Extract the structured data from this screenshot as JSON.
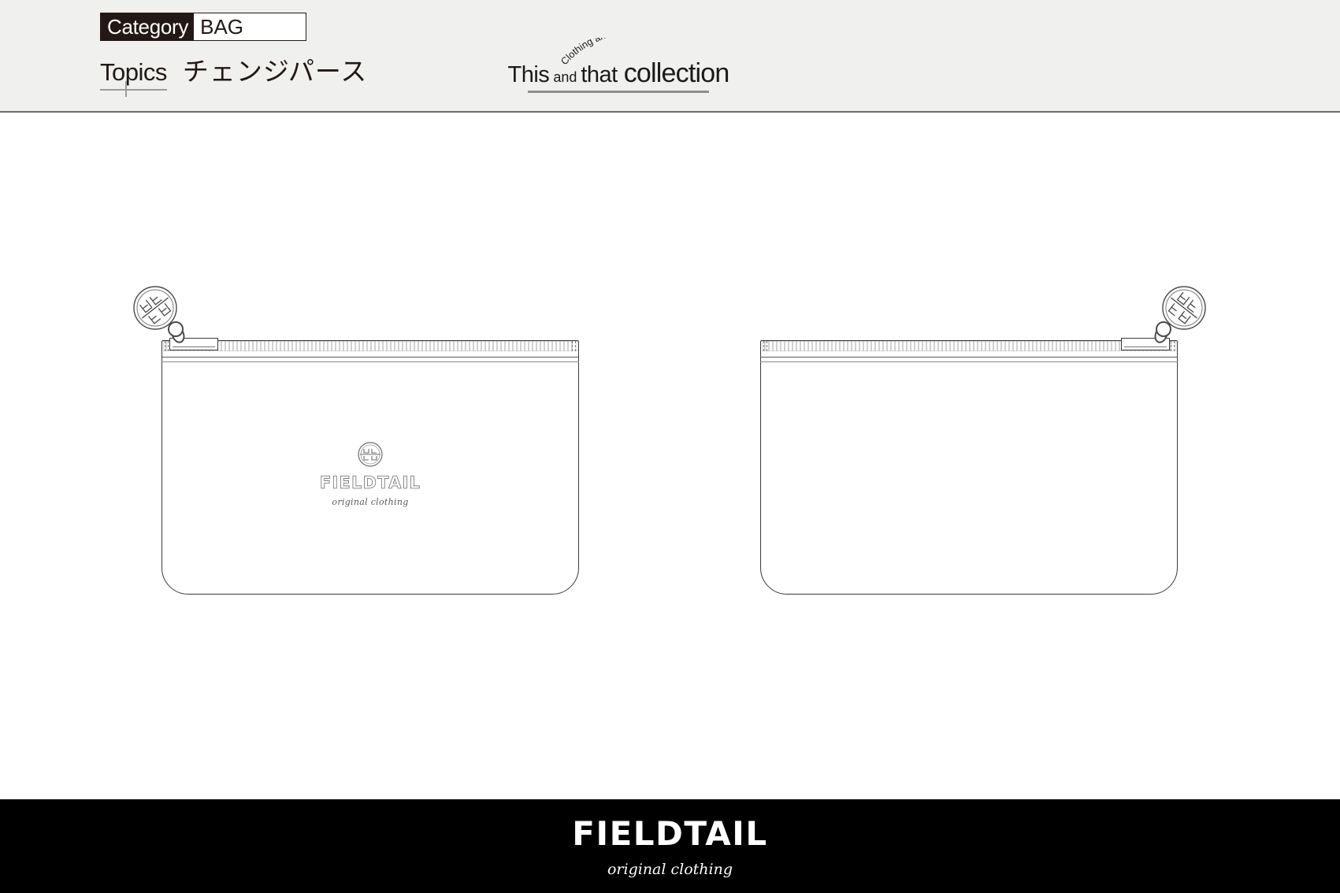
{
  "header": {
    "category_label": "Category",
    "category_value": "BAG",
    "topics_label": "Topics",
    "topics_value": "チェンジパース",
    "brand": {
      "arc_text": "Clothing and accessories",
      "word_this": "This",
      "word_and": "and",
      "word_that": "that",
      "word_collection": "collection"
    }
  },
  "artboard": {
    "products": [
      {
        "name": "change-purse-front",
        "view": "front",
        "print": {
          "emblem": "fieldtail-monogram-emblem",
          "wordmark": "FIELDTAIL",
          "tagline": "original clothing"
        },
        "zipper": {
          "pull_side": "left",
          "charm": "fieldtail-round-logo-charm"
        }
      },
      {
        "name": "change-purse-back",
        "view": "back",
        "print": null,
        "zipper": {
          "pull_side": "right",
          "charm": "fieldtail-round-logo-charm"
        }
      }
    ]
  },
  "footer": {
    "brand": "FIELDTAIL",
    "tagline": "original clothing"
  },
  "colors": {
    "header_bg": "#f0f0ee",
    "tag_bg": "#231815",
    "footer_bg": "#000000",
    "line": "#3a3a3a",
    "page_bg": "#ffffff"
  }
}
